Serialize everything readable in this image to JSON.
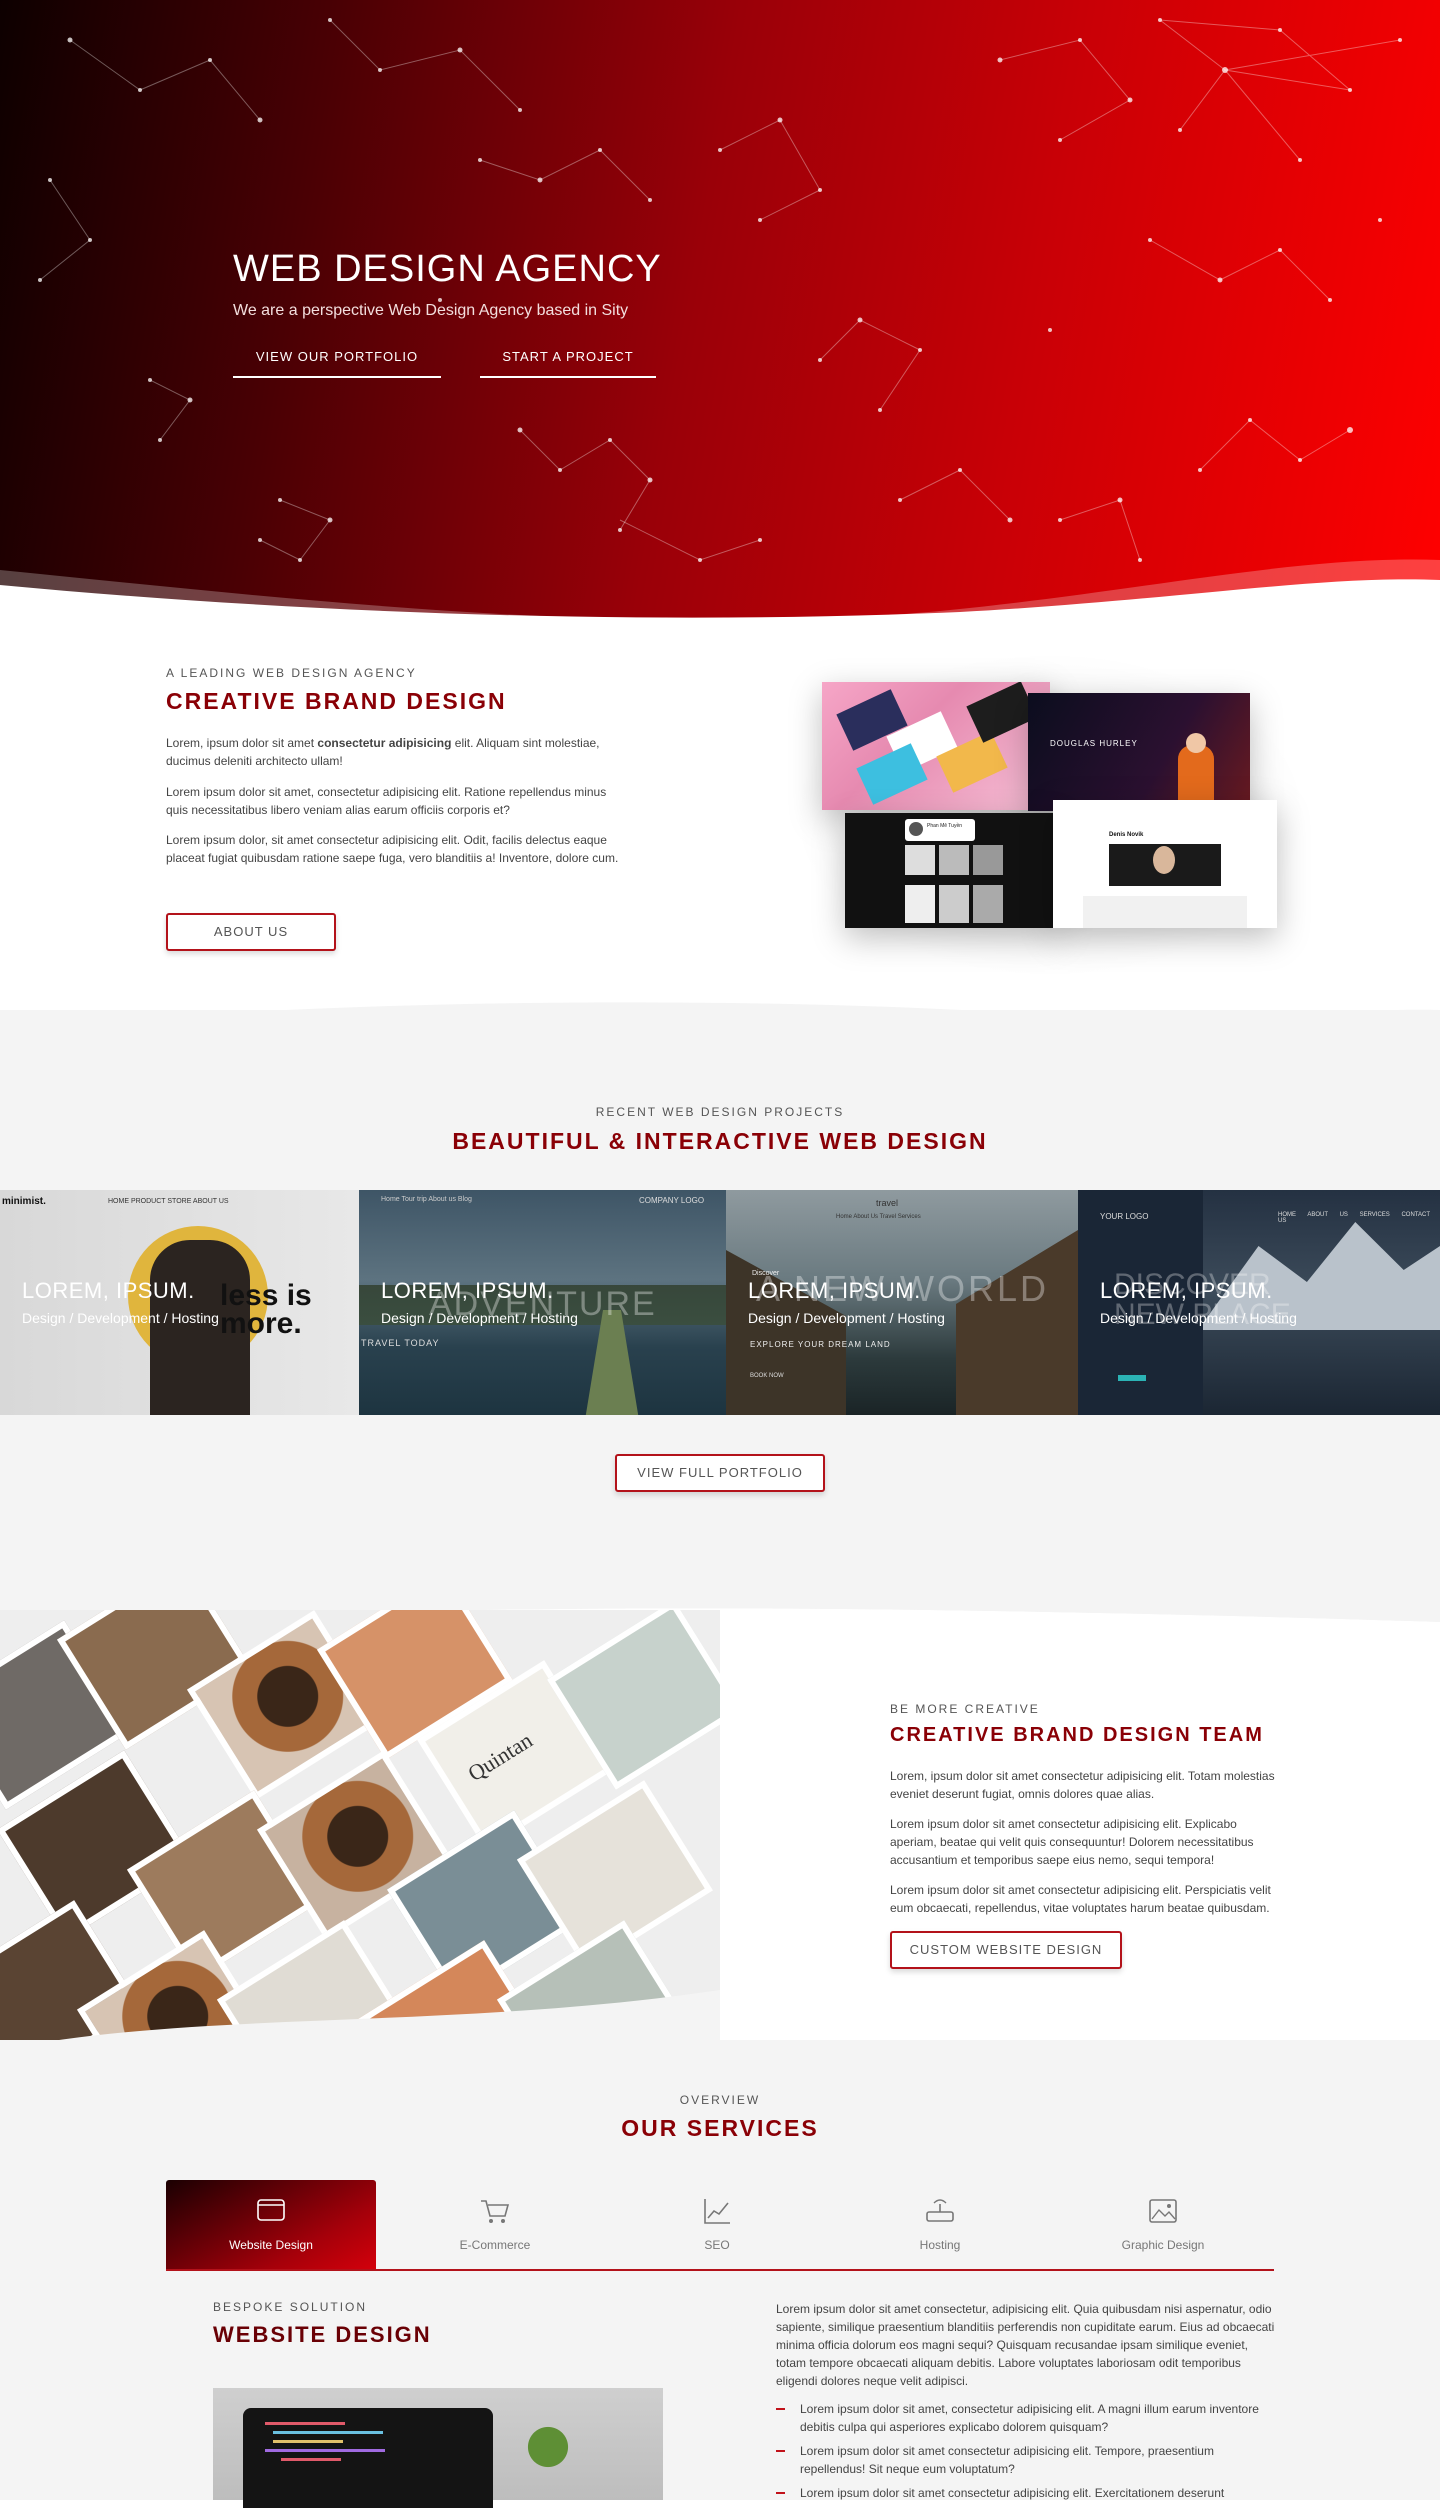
{
  "hero": {
    "title": "WEB DESIGN AGENCY",
    "subtitle": "We are a perspective Web Design Agency based in Sity",
    "btn_portfolio": "VIEW OUR PORTFOLIO",
    "btn_project": "START A PROJECT"
  },
  "about": {
    "kicker": "A LEADING WEB DESIGN AGENCY",
    "title": "CREATIVE BRAND DESIGN",
    "p1_a": "Lorem, ipsum dolor sit amet ",
    "p1_b": "consectetur adipisicing",
    "p1_c": " elit. Aliquam sint molestiae, ducimus deleniti architecto ullam!",
    "p2": "Lorem ipsum dolor sit amet, consectetur adipisicing elit. Ratione repellendus minus quis necessitatibus libero veniam alias earum officiis corporis et?",
    "p3": "Lorem ipsum dolor, sit amet consectetur adipisicing elit. Odit, facilis delectus eaque placeat fugiat quibusdam ratione saepe fuga, vero blanditiis a! Inventore, dolore cum.",
    "button": "ABOUT US",
    "mock_name1": "DOUGLAS HURLEY",
    "mock_name2": "Denis Novik",
    "mock_name3": "Phan Mê Tuyền"
  },
  "projects": {
    "kicker": "RECENT WEB DESIGN PROJECTS",
    "title": "BEAUTIFUL & INTERACTIVE WEB DESIGN",
    "items": [
      {
        "title": "LOREM, IPSUM.",
        "sub": "Design / Development / Hosting",
        "bg": "less is more.",
        "logo": "minimist.",
        "nav": "HOME  PRODUCT  STORE  ABOUT US"
      },
      {
        "title": "LOREM, IPSUM.",
        "sub": "Design / Development / Hosting",
        "bg": "ADVENTURE",
        "logo": "COMPANY LOGO",
        "nav": "Home  Tour trip  About us  Blog",
        "small": "TRAVEL TODAY"
      },
      {
        "title": "LOREM, IPSUM.",
        "sub": "Design / Development / Hosting",
        "bg": "A NEW WORLD",
        "logo": "travel",
        "nav": "Home  About Us  Travel  Services",
        "small": "EXPLORE YOUR DREAM LAND",
        "extra": "Discover",
        "btn": "BOOK NOW"
      },
      {
        "title": "LOREM, IPSUM.",
        "sub": "Design / Development / Hosting",
        "bg": "DISCOVER NEW PLACE",
        "logo": "YOUR LOGO",
        "nav": "HOME  ABOUT US  SERVICES  CONTACT US"
      }
    ],
    "button": "VIEW FULL PORTFOLIO"
  },
  "team": {
    "kicker": "BE MORE CREATIVE",
    "title": "CREATIVE BRAND DESIGN TEAM",
    "p1": "Lorem, ipsum dolor sit amet consectetur adipisicing elit. Totam molestias eveniet deserunt fugiat, omnis dolores quae alias.",
    "p2": "Lorem ipsum dolor sit amet consectetur adipisicing elit. Explicabo aperiam, beatae qui velit quis consequuntur! Dolorem necessitatibus accusantium et temporibus saepe eius nemo, sequi tempora!",
    "p3": "Lorem ipsum dolor sit amet consectetur adipisicing elit. Perspiciatis velit eum obcaecati, repellendus, vitae voluptates harum beatae quibusdam.",
    "button": "CUSTOM WEBSITE DESIGN",
    "card_text": "Quintan"
  },
  "services": {
    "kicker": "OVERVIEW",
    "title": "OUR SERVICES",
    "tabs": [
      {
        "label": "Website Design",
        "icon": "browser-window-icon"
      },
      {
        "label": "E-Commerce",
        "icon": "shopping-cart-icon"
      },
      {
        "label": "SEO",
        "icon": "chart-line-icon"
      },
      {
        "label": "Hosting",
        "icon": "router-icon"
      },
      {
        "label": "Graphic Design",
        "icon": "image-icon"
      }
    ],
    "active_kicker": "BESPOKE SOLUTION",
    "active_title": "WEBSITE DESIGN",
    "body": "Lorem ipsum dolor sit amet consectetur, adipisicing elit. Quia quibusdam nisi aspernatur, odio sapiente, similique praesentium blanditiis perferendis non cupiditate earum. Eius ad obcaecati minima officia dolorum eos magni sequi? Quisquam recusandae ipsam similique eveniet, totam tempore obcaecati aliquam debitis. Labore voluptates laboriosam odit temporibus eligendi dolores neque velit adipisci.",
    "bullets": [
      "Lorem ipsum dolor sit amet, consectetur adipisicing elit. A magni illum earum inventore debitis culpa qui asperiores explicabo dolorem quisquam?",
      "Lorem ipsum dolor sit amet consectetur adipisicing elit. Tempore, praesentium repellendus! Sit neque eum voluptatum?",
      "Lorem ipsum dolor sit amet consectetur adipisicing elit. Exercitationem deserunt"
    ]
  },
  "colors": {
    "accent": "#8a0006",
    "hero_bright": "#ff0000",
    "hero_dark": "#0d0000",
    "band": "#f4f4f4"
  }
}
